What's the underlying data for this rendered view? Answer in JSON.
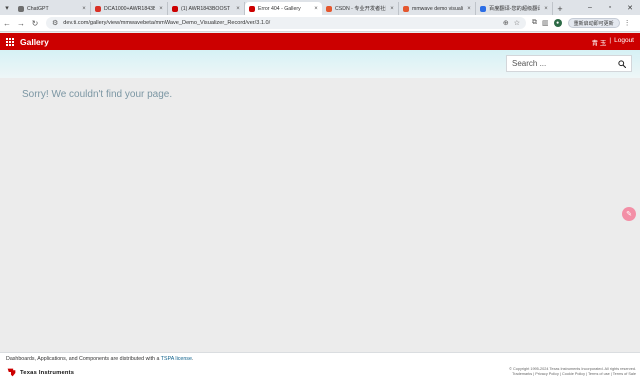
{
  "browser": {
    "tabs": [
      {
        "label": "ChatGPT",
        "color": "#6e6e6e",
        "active": false
      },
      {
        "label": "DCA1000+AWR1843BO",
        "color": "#d93025",
        "active": false
      },
      {
        "label": "(1) AWR1843BOOST",
        "color": "#cc0000",
        "active": false
      },
      {
        "label": "Error 404 - Gallery",
        "color": "#cc0000",
        "active": true
      },
      {
        "label": "CSDN - 专业开发者社区",
        "color": "#e4572e",
        "active": false
      },
      {
        "label": "mmwave demo visuali",
        "color": "#e4572e",
        "active": false
      },
      {
        "label": "百度翻译-您的超级翻译伙",
        "color": "#2b6de5",
        "active": false
      }
    ],
    "url": "dev.ti.com/gallery/view/mmwavebeta/mmWave_Demo_Visualizer_Record/ver/3.1.0/",
    "login_button": "重新启动即可更新"
  },
  "header": {
    "title": "Gallery",
    "user_name": "青 玉",
    "separator": "|",
    "logout_label": "Logout"
  },
  "search": {
    "placeholder": "Search ..."
  },
  "main": {
    "message": "Sorry! We couldn't find your page."
  },
  "footer": {
    "license_text": "Dashboards, Applications, and Components are distributed with a",
    "license_link": "TSPA license",
    "license_end": ".",
    "brand": "Texas Instruments",
    "copyright": "© Copyright 1995-2024 Texas Instruments Incorporated. All rights reserved.",
    "legal_links": "Trademarks | Privacy Policy | Cookie Policy | Terms of use | Terms of Sale"
  },
  "colors": {
    "header_bg": "#cc0000",
    "accent_link": "#0b5f8a",
    "message_text": "#7b96a3"
  }
}
